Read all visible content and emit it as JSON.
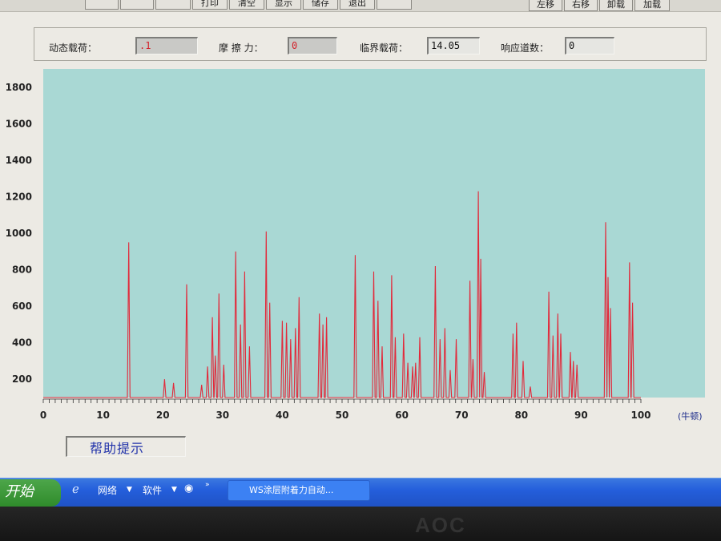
{
  "toolbar": {
    "left_buttons": [
      "",
      "",
      "",
      "打印",
      "清空",
      "显示",
      "储存",
      "退出"
    ],
    "right_buttons": [
      "左移",
      "右移",
      "卸载",
      "加载"
    ]
  },
  "readouts": {
    "dynamic_load_label": "动态载荷：",
    "dynamic_load_value": ".1",
    "friction_label": "摩 擦 力：",
    "friction_value": "0",
    "critical_load_label": "临界载荷：",
    "critical_load_value": "14.05",
    "response_channels_label": "响应道数：",
    "response_channels_value": "0"
  },
  "chart_data": {
    "type": "line",
    "x_unit_label": "(牛顿)",
    "xlim": [
      0,
      100
    ],
    "ylim": [
      100,
      1900
    ],
    "x_ticks": [
      0,
      10,
      20,
      30,
      40,
      50,
      60,
      70,
      80,
      90,
      100
    ],
    "y_ticks": [
      200,
      400,
      600,
      800,
      1000,
      1200,
      1400,
      1600,
      1800
    ],
    "plot_bg": "#a9d8d4",
    "line_color": "#e2293a",
    "baseline": 100,
    "peaks": [
      [
        14.3,
        950
      ],
      [
        20.3,
        200
      ],
      [
        21.8,
        180
      ],
      [
        24,
        720
      ],
      [
        26.5,
        170
      ],
      [
        27.5,
        270
      ],
      [
        28.3,
        540
      ],
      [
        28.8,
        330
      ],
      [
        29.4,
        670
      ],
      [
        30.2,
        280
      ],
      [
        32.2,
        900
      ],
      [
        33,
        500
      ],
      [
        33.7,
        790
      ],
      [
        34.5,
        380
      ],
      [
        37.3,
        1010
      ],
      [
        37.9,
        620
      ],
      [
        40,
        520
      ],
      [
        40.7,
        510
      ],
      [
        41.4,
        420
      ],
      [
        42.2,
        480
      ],
      [
        42.8,
        650
      ],
      [
        46.2,
        560
      ],
      [
        46.8,
        500
      ],
      [
        47.4,
        540
      ],
      [
        52.2,
        880
      ],
      [
        55.3,
        790
      ],
      [
        56,
        630
      ],
      [
        56.7,
        380
      ],
      [
        58.3,
        770
      ],
      [
        58.9,
        430
      ],
      [
        60.3,
        450
      ],
      [
        61,
        290
      ],
      [
        61.8,
        270
      ],
      [
        62.3,
        290
      ],
      [
        63,
        430
      ],
      [
        65.6,
        820
      ],
      [
        66.4,
        420
      ],
      [
        67.2,
        480
      ],
      [
        68.1,
        250
      ],
      [
        69.1,
        420
      ],
      [
        71.4,
        740
      ],
      [
        71.9,
        310
      ],
      [
        72.8,
        1230
      ],
      [
        73.2,
        860
      ],
      [
        73.8,
        240
      ],
      [
        78.6,
        450
      ],
      [
        79.2,
        510
      ],
      [
        80.3,
        300
      ],
      [
        81.5,
        160
      ],
      [
        84.6,
        680
      ],
      [
        85.3,
        440
      ],
      [
        86.1,
        560
      ],
      [
        86.6,
        450
      ],
      [
        88.2,
        350
      ],
      [
        88.7,
        300
      ],
      [
        89.3,
        280
      ],
      [
        94.1,
        1060
      ],
      [
        94.5,
        760
      ],
      [
        94.9,
        590
      ],
      [
        98.1,
        840
      ],
      [
        98.6,
        620
      ]
    ]
  },
  "help": {
    "label": "帮助提示"
  },
  "taskbar": {
    "start_label": "开始",
    "network_label": "网络",
    "software_label": "软件",
    "task_title": "WS涂层附着力自动..."
  },
  "monitor": {
    "brand": "AOC"
  }
}
